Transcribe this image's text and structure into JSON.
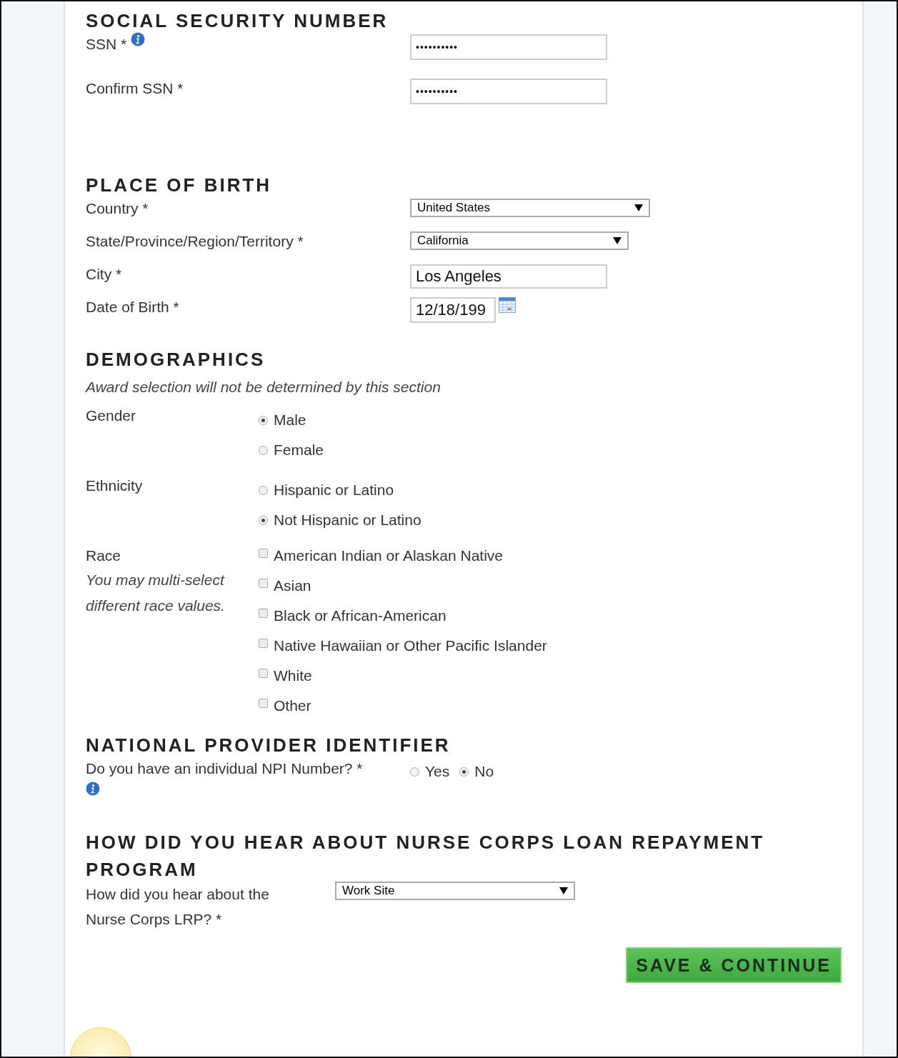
{
  "sections": [
    {
      "kind": "fields",
      "title": "SOCIAL SECURITY NUMBER",
      "rows": [
        {
          "kind": "password",
          "label": "SSN *",
          "info": true,
          "value": "••••••••••"
        },
        {
          "kind": "password",
          "label": "Confirm SSN *",
          "info": false,
          "value": "••••••••••"
        }
      ]
    },
    {
      "kind": "fields",
      "title": "PLACE OF BIRTH",
      "rows": [
        {
          "kind": "select",
          "label": "Country *",
          "info": false,
          "value": "United States"
        },
        {
          "kind": "select",
          "label": "State/Province/Region/Territory *",
          "info": false,
          "value": "California"
        },
        {
          "kind": "text",
          "label": "City *",
          "info": false,
          "value": "Los Angeles"
        },
        {
          "kind": "date",
          "label": "Date of Birth *",
          "info": false,
          "value": "12/18/199"
        }
      ]
    },
    {
      "kind": "demographics",
      "title": "DEMOGRAPHICS",
      "note": "Award selection will not be determined by this section",
      "rows": [
        {
          "kind": "radio",
          "label": "Gender",
          "options": [
            {
              "label": "Male",
              "selected": true
            },
            {
              "label": "Female",
              "selected": false
            }
          ]
        },
        {
          "kind": "radio",
          "label": "Ethnicity",
          "options": [
            {
              "label": "Hispanic or Latino",
              "selected": false
            },
            {
              "label": "Not Hispanic or Latino",
              "selected": true
            }
          ]
        },
        {
          "kind": "checkbox",
          "label": "Race",
          "hint": "You may multi-select different race values.",
          "options": [
            {
              "label": "American Indian or Alaskan Native",
              "checked": false
            },
            {
              "label": "Asian",
              "checked": false
            },
            {
              "label": "Black or African-American",
              "checked": false
            },
            {
              "label": "Native Hawaiian or Other Pacific Islander",
              "checked": false
            },
            {
              "label": "White",
              "checked": false
            },
            {
              "label": "Other",
              "checked": false
            }
          ]
        }
      ]
    },
    {
      "kind": "npi",
      "title": "NATIONAL PROVIDER IDENTIFIER",
      "rows": [
        {
          "kind": "inline-radio",
          "label": "Do you have an individual NPI Number? *",
          "info": true,
          "options": [
            {
              "label": "Yes",
              "selected": false
            },
            {
              "label": "No",
              "selected": true
            }
          ]
        }
      ]
    },
    {
      "kind": "hear",
      "title": "HOW DID YOU HEAR ABOUT NURSE CORPS LOAN REPAYMENT PROGRAM",
      "rows": [
        {
          "kind": "select",
          "label": "How did you hear about the Nurse Corps LRP? *",
          "info": false,
          "value": "Work Site"
        }
      ]
    }
  ],
  "button": "SAVE & CONTINUE"
}
